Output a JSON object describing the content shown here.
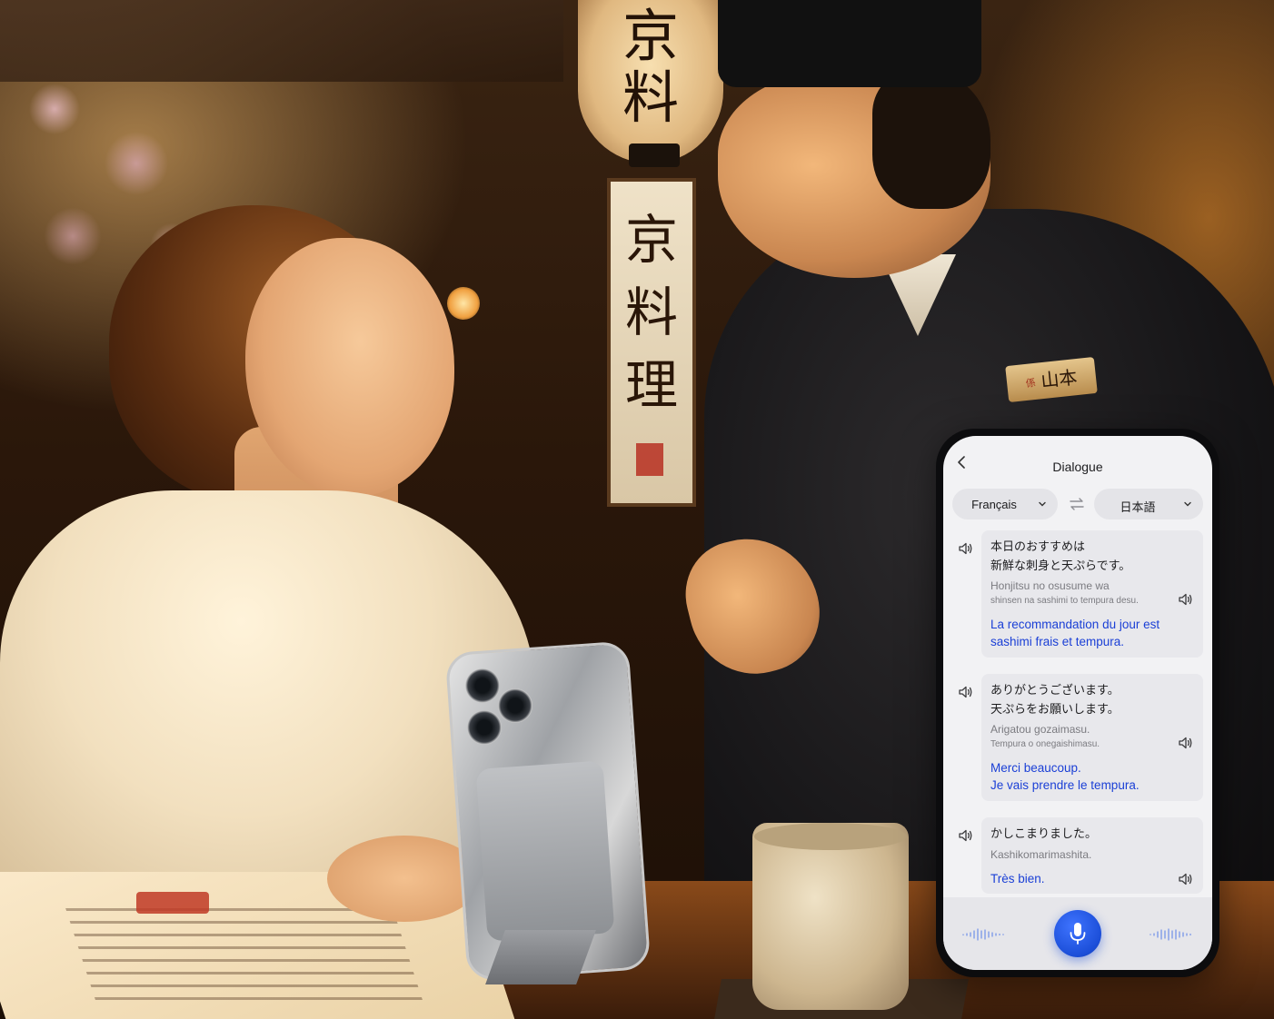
{
  "scene": {
    "lantern_text": "京料",
    "sign_text": "京料理",
    "name_tag": "山本",
    "name_tag_mark": "係"
  },
  "colors": {
    "accent_blue": "#1a3fd6",
    "mic_blue": "#1b4ed8",
    "screen_bg": "#f2f2f4",
    "bubble_bg": "#e8e8ec"
  },
  "app": {
    "title": "Dialogue",
    "back_icon": "chevron-left-icon",
    "source_language": "Français",
    "target_language": "日本語",
    "swap_icon": "swap-arrows-icon",
    "dropdown_icon": "chevron-down-icon"
  },
  "messages": [
    {
      "japanese_line1": "本日のおすすめは",
      "japanese_line2": "新鮮な刺身と天ぷらです。",
      "romaji_line1": "Honjitsu no osusume wa",
      "romaji_line2": "shinsen na sashimi to tempura desu.",
      "french_line1": "La recommandation du jour est",
      "french_line2": "sashimi frais et tempura."
    },
    {
      "japanese_line1": "ありがとうございます。",
      "japanese_line2": "天ぷらをお願いします。",
      "romaji_line1": "Arigatou gozaimasu.",
      "romaji_line2": "Tempura o onegaishimasu.",
      "french_line1": "Merci beaucoup.",
      "french_line2": "Je vais prendre le tempura."
    },
    {
      "japanese_line1": "かしこまりました。",
      "romaji_line1": "Kashikomarimashita.",
      "french_line1": "Très bien."
    }
  ],
  "controls": {
    "mic_icon": "microphone-icon",
    "wave_icon": "audio-wave-icon"
  }
}
